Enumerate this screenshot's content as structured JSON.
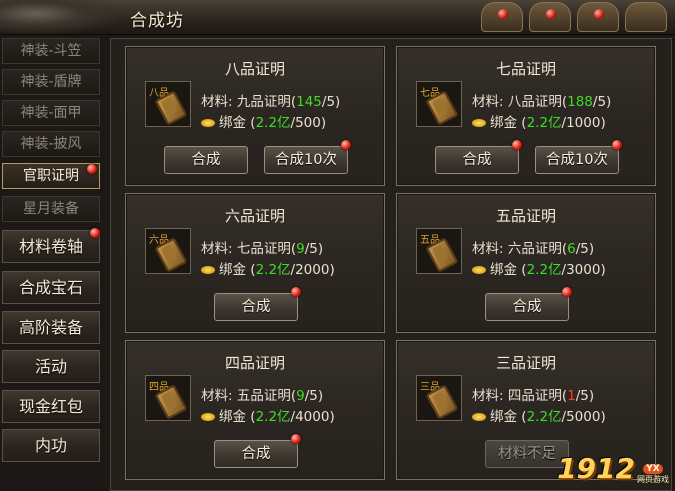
{
  "window": {
    "title": "合成坊"
  },
  "sidebar": {
    "sub_items": [
      {
        "label": "神装-斗笠",
        "active": false,
        "badge": false
      },
      {
        "label": "神装-盾牌",
        "active": false,
        "badge": false
      },
      {
        "label": "神装-面甲",
        "active": false,
        "badge": false
      },
      {
        "label": "神装-披风",
        "active": false,
        "badge": false
      },
      {
        "label": "官职证明",
        "active": true,
        "badge": true
      },
      {
        "label": "星月装备",
        "active": false,
        "badge": false
      }
    ],
    "main_items": [
      {
        "label": "材料卷轴",
        "badge": true
      },
      {
        "label": "合成宝石",
        "badge": false
      },
      {
        "label": "高阶装备",
        "badge": false
      },
      {
        "label": "活动",
        "badge": false
      },
      {
        "label": "现金红包",
        "badge": false
      },
      {
        "label": "内功",
        "badge": false
      }
    ]
  },
  "cards": [
    {
      "title": "八品证明",
      "grade": "八品",
      "mat_label": "材料: ",
      "mat_name": "九品证明",
      "have": "145",
      "need": "/5",
      "have_ok": true,
      "gold_label": "绑金",
      "gold_have": "2.2亿",
      "gold_need": "/500",
      "buttons": [
        {
          "label": "合成",
          "badge": false,
          "enabled": true
        },
        {
          "label": "合成10次",
          "badge": true,
          "enabled": true
        }
      ]
    },
    {
      "title": "七品证明",
      "grade": "七品",
      "mat_label": "材料: ",
      "mat_name": "八品证明",
      "have": "188",
      "need": "/5",
      "have_ok": true,
      "gold_label": "绑金",
      "gold_have": "2.2亿",
      "gold_need": "/1000",
      "buttons": [
        {
          "label": "合成",
          "badge": true,
          "enabled": true
        },
        {
          "label": "合成10次",
          "badge": true,
          "enabled": true
        }
      ]
    },
    {
      "title": "六品证明",
      "grade": "六品",
      "mat_label": "材料: ",
      "mat_name": "七品证明",
      "have": "9",
      "need": "/5",
      "have_ok": true,
      "gold_label": "绑金",
      "gold_have": "2.2亿",
      "gold_need": "/2000",
      "buttons": [
        {
          "label": "合成",
          "badge": true,
          "enabled": true
        }
      ]
    },
    {
      "title": "五品证明",
      "grade": "五品",
      "mat_label": "材料: ",
      "mat_name": "六品证明",
      "have": "6",
      "need": "/5",
      "have_ok": true,
      "gold_label": "绑金",
      "gold_have": "2.2亿",
      "gold_need": "/3000",
      "buttons": [
        {
          "label": "合成",
          "badge": true,
          "enabled": true
        }
      ]
    },
    {
      "title": "四品证明",
      "grade": "四品",
      "mat_label": "材料: ",
      "mat_name": "五品证明",
      "have": "9",
      "need": "/5",
      "have_ok": true,
      "gold_label": "绑金",
      "gold_have": "2.2亿",
      "gold_need": "/4000",
      "buttons": [
        {
          "label": "合成",
          "badge": true,
          "enabled": true
        }
      ]
    },
    {
      "title": "三品证明",
      "grade": "三品",
      "mat_label": "材料: ",
      "mat_name": "四品证明",
      "have": "1",
      "need": "/5",
      "have_ok": false,
      "gold_label": "绑金",
      "gold_have": "2.2亿",
      "gold_need": "/5000",
      "buttons": [
        {
          "label": "材料不足",
          "badge": false,
          "enabled": false
        }
      ]
    }
  ],
  "watermark": {
    "number": "1912",
    "badge": "YX",
    "sub": "网页游戏"
  },
  "colors": {
    "ok": "#3fdc2a",
    "insufficient": "#ff3b2b",
    "grade_text": "#e6a531"
  }
}
